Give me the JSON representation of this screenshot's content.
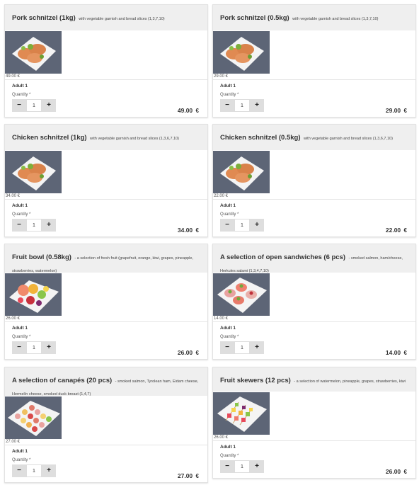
{
  "products": [
    {
      "title": "Pork schnitzel (1kg)",
      "subtitle": "with vegetable garnish and bread slices (1,3,7,10)",
      "price": "49.00 €",
      "person": "Adult 1",
      "quantity_label": "Quantity *",
      "quantity": "1",
      "total": "49.00",
      "currency": "€",
      "image": "schnitzel-plate"
    },
    {
      "title": "Pork schnitzel (0.5kg)",
      "subtitle": "with vegetable garnish and bread slices (1,3,7,10)",
      "price": "29.00 €",
      "person": "Adult 1",
      "quantity_label": "Quantity *",
      "quantity": "1",
      "total": "29.00",
      "currency": "€",
      "image": "schnitzel-plate"
    },
    {
      "title": "Chicken schnitzel (1kg)",
      "subtitle": "with vegetable garnish and bread slices (1,3,6,7,10)",
      "price": "34.00 €",
      "person": "Adult 1",
      "quantity_label": "Quantity *",
      "quantity": "1",
      "total": "34.00",
      "currency": "€",
      "image": "schnitzel-plate"
    },
    {
      "title": "Chicken schnitzel (0.5kg)",
      "subtitle": "with vegetable garnish and bread slices (1,3,6,7,10)",
      "price": "22.00 €",
      "person": "Adult 1",
      "quantity_label": "Quantity *",
      "quantity": "1",
      "total": "22.00",
      "currency": "€",
      "image": "schnitzel-plate"
    },
    {
      "title": "Fruit bowl (0.58kg)",
      "subtitle": "- a selection of fresh fruit (grapefruit, orange, kiwi, grapes, pineapple, strawberries, watermelon)",
      "price": "26.00 €",
      "person": "Adult 1",
      "quantity_label": "Quantity *",
      "quantity": "1",
      "total": "26.00",
      "currency": "€",
      "image": "fruit-bowl"
    },
    {
      "title": "A selection of open sandwiches (6 pcs)",
      "subtitle": "- smoked salmon, ham/cheese, Herkules salami (1,3,4,7,10)",
      "price": "14.00 €",
      "person": "Adult 1",
      "quantity_label": "Quantity *",
      "quantity": "1",
      "total": "14.00",
      "currency": "€",
      "image": "open-sandwiches"
    },
    {
      "title": "A selection of canapés (20 pcs)",
      "subtitle": "- smoked salmon, Tyrolean ham, Eidam cheese, Hermelín cheese, smoked duck breast (1,4,7)",
      "price": "27.00 €",
      "person": "Adult 1",
      "quantity_label": "Quantity *",
      "quantity": "1",
      "total": "27.00",
      "currency": "€",
      "image": "canapes"
    },
    {
      "title": "Fruit skewers (12 pcs)",
      "subtitle": "- a selection of watermelon, pineapple, grapes, strawberries, kiwi",
      "price": "26.00 €",
      "person": "Adult 1",
      "quantity_label": "Quantity *",
      "quantity": "1",
      "total": "26.00",
      "currency": "€",
      "image": "fruit-skewers"
    }
  ],
  "controls": {
    "minus": "−",
    "plus": "+"
  }
}
